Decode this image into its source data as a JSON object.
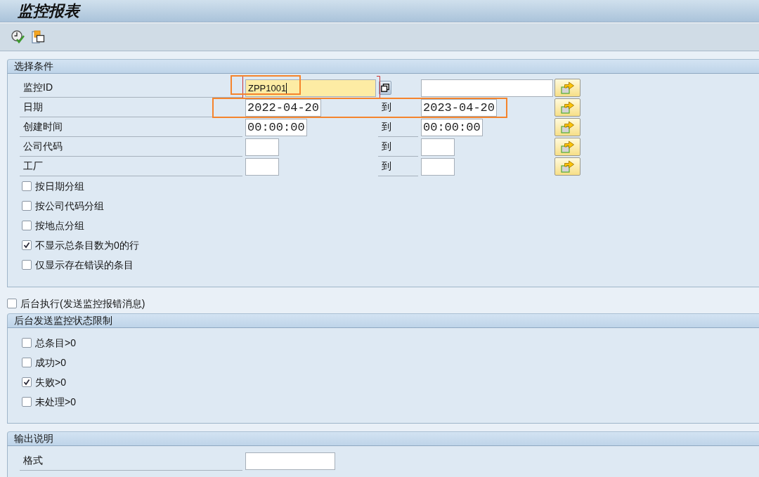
{
  "window": {
    "title": "监控报表"
  },
  "selection": {
    "title": "选择条件",
    "ranges": [
      {
        "kind": "id",
        "label": "监控ID",
        "low": "ZPP1001",
        "focused": true,
        "highlighted": true
      },
      {
        "kind": "date",
        "label": "日期",
        "low": "2022-04-20",
        "to": "到",
        "high": "2023-04-20",
        "focused": false,
        "highlighted": true
      },
      {
        "kind": "time",
        "label": "创建时间",
        "low": "00:00:00",
        "to": "到",
        "high": "00:00:00",
        "focused": false,
        "highlighted": false
      },
      {
        "kind": "code",
        "label": "公司代码",
        "to": "到",
        "focused": false,
        "highlighted": false
      },
      {
        "kind": "code",
        "label": "工厂",
        "to": "到",
        "focused": false,
        "highlighted": false
      }
    ],
    "options": [
      {
        "label": "按日期分组",
        "checked": false
      },
      {
        "label": "按公司代码分组",
        "checked": false
      },
      {
        "label": "按地点分组",
        "checked": false
      },
      {
        "label": "不显示总条目数为0的行",
        "checked": true
      },
      {
        "label": "仅显示存在错误的条目",
        "checked": false
      }
    ]
  },
  "background_run": {
    "label": "后台执行(发送监控报错消息)",
    "checked": false
  },
  "status_limits": {
    "title": "后台发送监控状态限制",
    "options": [
      {
        "label": "总条目>0",
        "checked": false
      },
      {
        "label": "成功>0",
        "checked": false
      },
      {
        "label": "失败>0",
        "checked": true
      },
      {
        "label": "未处理>0",
        "checked": false
      }
    ]
  },
  "output": {
    "title": "输出说明",
    "fields": [
      {
        "label": "格式"
      }
    ]
  }
}
